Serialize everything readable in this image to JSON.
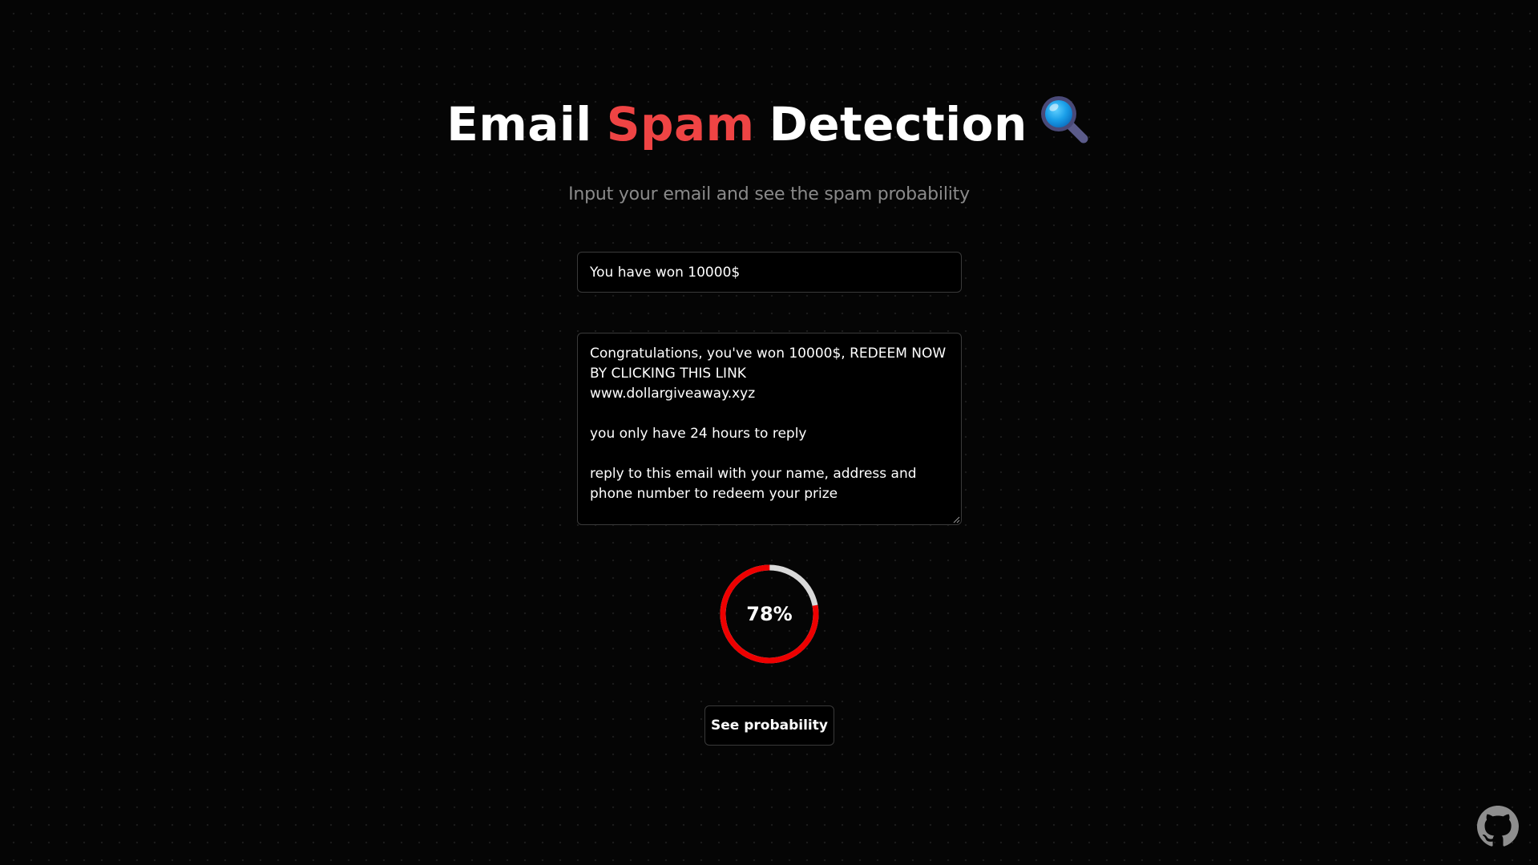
{
  "header": {
    "title_part1": "Email",
    "title_accent": "Spam",
    "title_part2": "Detection",
    "icon": "magnifying-glass-icon",
    "accent_color": "#ef4444"
  },
  "subtitle": "Input your email and see the spam probability",
  "form": {
    "subject_value": "You have won 10000$",
    "body_value": "Congratulations, you've won 10000$, REDEEM NOW BY CLICKING THIS LINK\nwww.dollargiveaway.xyz\n\nyou only have 24 hours to reply\n\nreply to this email with your name, address and phone number to redeem your prize"
  },
  "result": {
    "probability_percent": 78,
    "probability_label": "78%",
    "ring_color": "#ee0000",
    "track_color": "#d9d9d9"
  },
  "actions": {
    "submit_label": "See probability"
  },
  "footer": {
    "github_icon": "github-icon"
  }
}
